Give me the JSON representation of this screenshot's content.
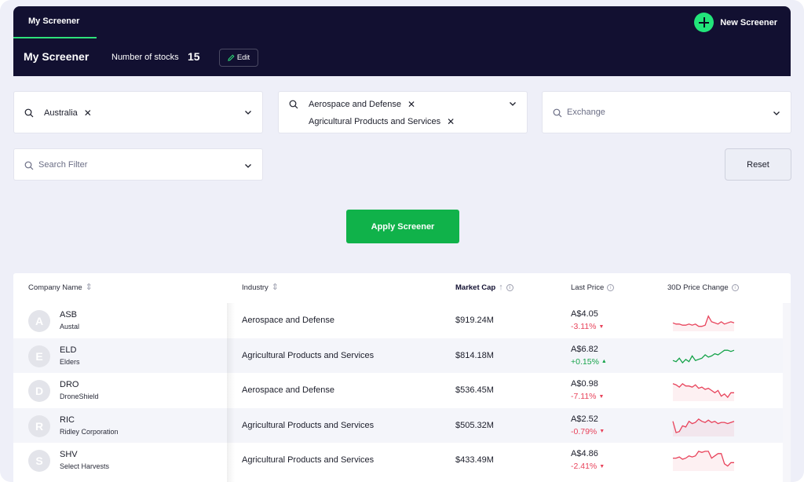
{
  "header": {
    "tab_label": "My Screener",
    "new_screener_label": "New Screener",
    "title": "My Screener",
    "count_label": "Number of stocks",
    "count_value": "15",
    "edit_label": "Edit"
  },
  "filters": {
    "country": {
      "chips": [
        "Australia"
      ]
    },
    "industry": {
      "chips": [
        "Aerospace and Defense",
        "Agricultural Products and Services"
      ]
    },
    "exchange": {
      "placeholder": "Exchange"
    },
    "search": {
      "placeholder": "Search Filter"
    },
    "reset_label": "Reset",
    "apply_label": "Apply Screener"
  },
  "table": {
    "columns": {
      "company": "Company Name",
      "industry": "Industry",
      "market_cap": "Market Cap",
      "last_price": "Last Price",
      "price_change": "30D Price Change"
    },
    "rows": [
      {
        "initial": "A",
        "ticker": "ASB",
        "name": "Austal",
        "industry": "Aerospace and Defense",
        "market_cap": "$919.24M",
        "price": "A$4.05",
        "change": "-3.11%",
        "direction": "down",
        "spark": [
          6,
          5,
          5,
          4,
          4,
          5,
          4,
          5,
          3,
          3,
          4,
          12,
          7,
          6,
          5,
          7,
          5,
          6,
          7,
          6
        ]
      },
      {
        "initial": "E",
        "ticker": "ELD",
        "name": "Elders",
        "industry": "Agricultural Products and Services",
        "market_cap": "$814.18M",
        "price": "A$6.82",
        "change": "+0.15%",
        "direction": "up",
        "spark": [
          4,
          3,
          6,
          2,
          5,
          3,
          8,
          4,
          5,
          6,
          9,
          7,
          8,
          10,
          9,
          11,
          13,
          13,
          12,
          13
        ]
      },
      {
        "initial": "D",
        "ticker": "DRO",
        "name": "DroneShield",
        "industry": "Aerospace and Defense",
        "market_cap": "$536.45M",
        "price": "A$0.98",
        "change": "-7.11%",
        "direction": "down",
        "spark": [
          14,
          13,
          11,
          14,
          12,
          12,
          11,
          13,
          10,
          11,
          9,
          10,
          8,
          6,
          8,
          3,
          5,
          2,
          6,
          6
        ]
      },
      {
        "initial": "R",
        "ticker": "RIC",
        "name": "Ridley Corporation",
        "industry": "Agricultural Products and Services",
        "market_cap": "$505.32M",
        "price": "A$2.52",
        "change": "-0.79%",
        "direction": "down",
        "spark": [
          12,
          2,
          3,
          8,
          7,
          12,
          10,
          11,
          14,
          12,
          11,
          13,
          11,
          12,
          10,
          11,
          11,
          10,
          11,
          12
        ]
      },
      {
        "initial": "S",
        "ticker": "SHV",
        "name": "Select Harvests",
        "industry": "Agricultural Products and Services",
        "market_cap": "$433.49M",
        "price": "A$4.86",
        "change": "-2.41%",
        "direction": "down",
        "spark": [
          10,
          10,
          11,
          9,
          10,
          12,
          11,
          12,
          16,
          15,
          16,
          16,
          10,
          12,
          14,
          14,
          5,
          3,
          6,
          6
        ]
      }
    ]
  },
  "colors": {
    "header_bg": "#121031",
    "accent_green": "#22e57a",
    "apply_green": "#10b24a",
    "negative": "#e8435b",
    "positive": "#16a34a"
  }
}
